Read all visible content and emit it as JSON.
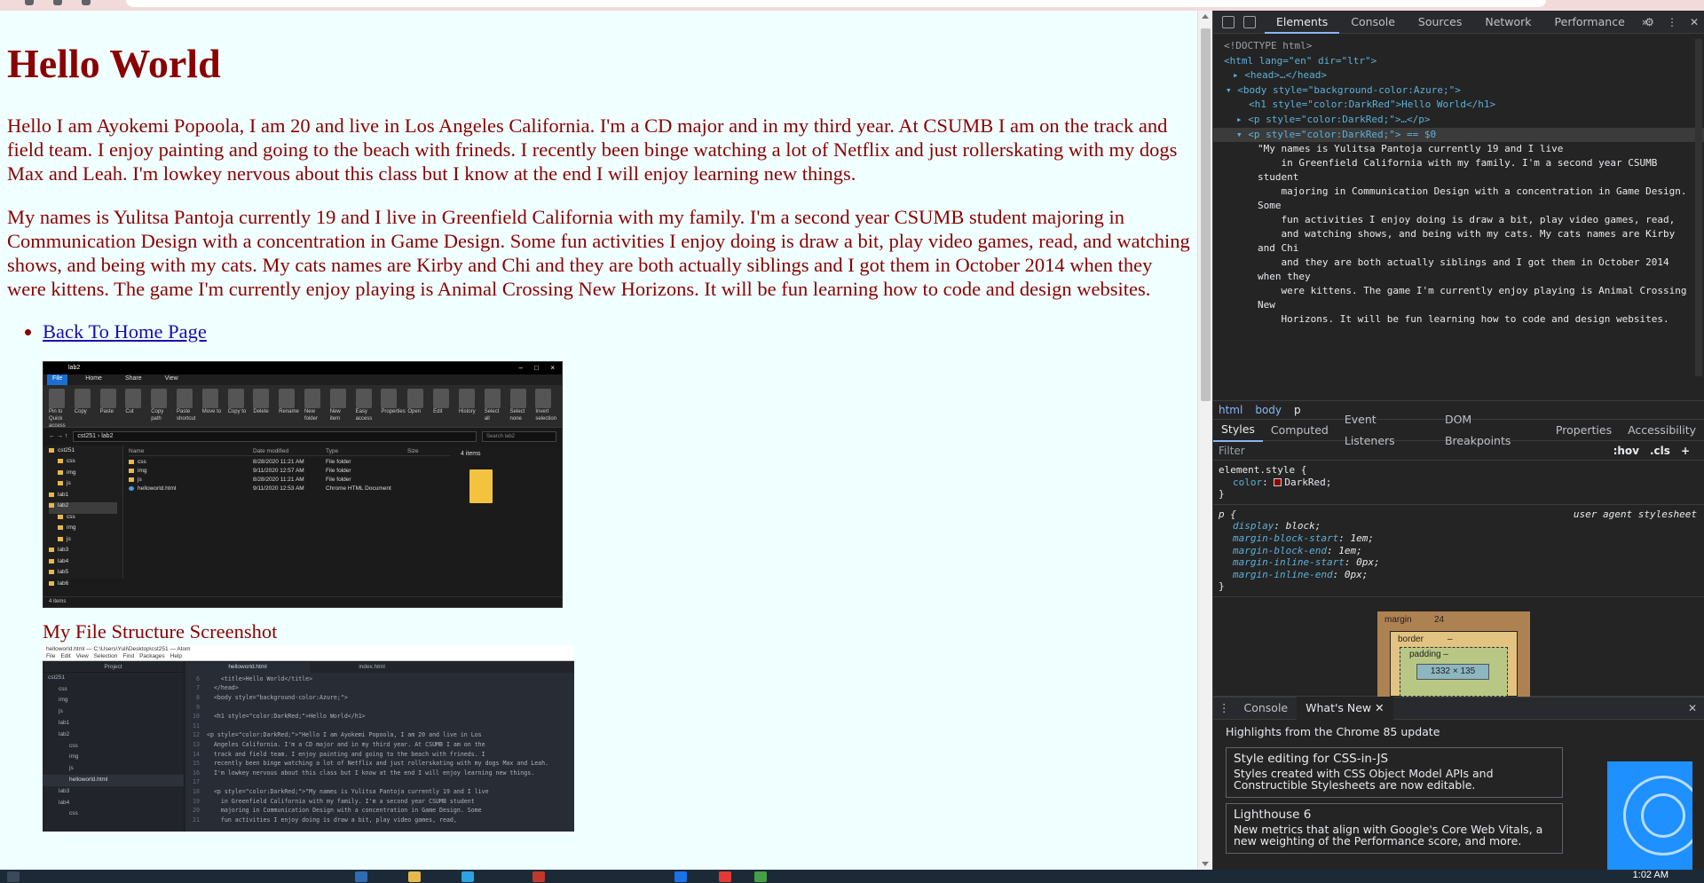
{
  "page": {
    "heading": "Hello World",
    "paragraph1": "Hello I am Ayokemi Popoola, I am 20 and live in Los Angeles California. I'm a CD major and in my third year. At CSUMB I am on the track and field team. I enjoy painting and going to the beach with frineds. I recently been binge watching a lot of Netflix and just rollerskating with my dogs Max and Leah. I'm lowkey nervous about this class but I know at the end I will enjoy learning new things.",
    "paragraph2": "My names is Yulitsa Pantoja currently 19 and I live in Greenfield California with my family. I'm a second year CSUMB student majoring in Communication Design with a concentration in Game Design. Some fun activities I enjoy doing is draw a bit, play video games, read, and watching shows, and being with my cats. My cats names are Kirby and Chi and they are both actually siblings and I got them in October 2014 when they were kittens. The game I'm currently enjoy playing is Animal Crossing New Horizons. It will be fun learning how to code and design websites.",
    "link": "Back To Home Page",
    "caption": "My File Structure Screenshot",
    "background": "#f0ffff",
    "text_color": "#8b0000"
  },
  "explorer": {
    "title": "lab2",
    "tabs": [
      "File",
      "Home",
      "Share",
      "View"
    ],
    "ribbon": [
      "Pin to Quick access",
      "Copy",
      "Paste",
      "Cut",
      "Copy path",
      "Paste shortcut",
      "Move to",
      "Copy to",
      "Delete",
      "Rename",
      "New folder",
      "New item",
      "Easy access",
      "Properties",
      "Open",
      "Edit",
      "History",
      "Select all",
      "Select none",
      "Invert selection"
    ],
    "address": "cst251 › lab2",
    "search": "Search lab2",
    "nav": [
      "cst251",
      "css",
      "img",
      "js",
      "lab1",
      "lab2",
      "css",
      "img",
      "js",
      "lab3",
      "lab4",
      "lab5",
      "lab6"
    ],
    "columns": [
      "Name",
      "Date modified",
      "Type",
      "Size"
    ],
    "rows": [
      {
        "name": "css",
        "date": "8/28/2020 11:21 AM",
        "type": "File folder",
        "size": ""
      },
      {
        "name": "img",
        "date": "9/11/2020 12:57 AM",
        "type": "File folder",
        "size": ""
      },
      {
        "name": "js",
        "date": "8/28/2020 11:21 AM",
        "type": "File folder",
        "size": ""
      },
      {
        "name": "helloworld.html",
        "date": "9/11/2020 12:53 AM",
        "type": "Chrome HTML Document",
        "size": ""
      }
    ],
    "count": "4 items",
    "status": "4 items"
  },
  "atom": {
    "title": "helloworld.html — C:\\Users\\Yuli\\Desktop\\cst251 — Atom",
    "menu": [
      "File",
      "Edit",
      "View",
      "Selection",
      "Find",
      "Packages",
      "Help"
    ],
    "tree_header": "Project",
    "tree": [
      "cst251",
      "css",
      "img",
      "js",
      "lab1",
      "lab2",
      "css",
      "img",
      "js",
      "helloworld.html",
      "lab3",
      "lab4",
      "css"
    ],
    "tabs": [
      "helloworld.html",
      "index.html"
    ],
    "lines": [
      {
        "n": "6",
        "t": "    <title>Hello World</title>"
      },
      {
        "n": "7",
        "t": "  </head>"
      },
      {
        "n": "8",
        "t": "  <body style=\"background-color:Azure;\">"
      },
      {
        "n": "9",
        "t": ""
      },
      {
        "n": "10",
        "t": "  <h1 style=\"color:DarkRed;\">Hello World</h1>"
      },
      {
        "n": "11",
        "t": ""
      },
      {
        "n": "12",
        "t": "<p style=\"color:DarkRed;\">\"Hello I am Ayokemi Popoola, I am 20 and live in Los"
      },
      {
        "n": "13",
        "t": "  Angeles California. I'm a CD major and in my third year. At CSUMB I am on the"
      },
      {
        "n": "14",
        "t": "  track and field team. I enjoy painting and going to the beach with frineds. I"
      },
      {
        "n": "15",
        "t": "  recently been binge watching a lot of Netflix and just rollerskating with my dogs Max and Leah."
      },
      {
        "n": "16",
        "t": "  I'm lowkey nervous about this class but I know at the end I will enjoy learning new things."
      },
      {
        "n": "17",
        "t": ""
      },
      {
        "n": "18",
        "t": "  <p style=\"color:DarkRed;\">\"My names is Yulitsa Pantoja currently 19 and I live"
      },
      {
        "n": "19",
        "t": "    in Greenfield California with my family. I'm a second year CSUMB student"
      },
      {
        "n": "20",
        "t": "    majoring in Communication Design with a concentration in Game Design. Some"
      },
      {
        "n": "21",
        "t": "    fun activities I enjoy doing is draw a bit, play video games, read,"
      }
    ]
  },
  "devtools": {
    "tabs": [
      "Elements",
      "Console",
      "Sources",
      "Network",
      "Performance"
    ],
    "more": "»",
    "dom": {
      "doctype": "<!DOCTYPE html>",
      "html_open": "<html lang=\"en\" dir=\"ltr\">",
      "head": "<head>…</head>",
      "body_open": "<body style=\"background-color:Azure;\">",
      "h1": "<h1 style=\"color:DarkRed\">Hello World</h1>",
      "p1": "<p style=\"color:DarkRed;\">…</p>",
      "p2": "<p style=\"color:DarkRed;\"> == $0",
      "text": "\"My names is Yulitsa Pantoja currently 19 and I live\n    in Greenfield California with my family. I'm a second year CSUMB student\n    majoring in Communication Design with a concentration in Game Design. Some\n    fun activities I enjoy doing is draw a bit, play video games, read,\n    and watching shows, and being with my cats. My cats names are Kirby and Chi\n    and they are both actually siblings and I got them in October 2014 when they\n    were kittens. The game I'm currently enjoy playing is Animal Crossing New\n    Horizons. It will be fun learning how to code and design websites."
    },
    "breadcrumbs": [
      "html",
      "body",
      "p"
    ],
    "style_tabs": [
      "Styles",
      "Computed",
      "Event Listeners",
      "DOM Breakpoints",
      "Properties",
      "Accessibility"
    ],
    "filter_placeholder": "Filter",
    "filter_hov": ":hov",
    "filter_cls": ".cls",
    "rule1": {
      "selector": "element.style {",
      "prop": "color",
      "value": "DarkRed;",
      "close": "}"
    },
    "rule2": {
      "selector": "p {",
      "source": "user agent stylesheet",
      "props": [
        {
          "p": "display",
          "v": "block;"
        },
        {
          "p": "margin-block-start",
          "v": "1em;"
        },
        {
          "p": "margin-block-end",
          "v": "1em;"
        },
        {
          "p": "margin-inline-start",
          "v": "0px;"
        },
        {
          "p": "margin-inline-end",
          "v": "0px;"
        }
      ],
      "close": "}"
    },
    "box": {
      "margin_label": "margin",
      "margin": "24",
      "border_label": "border",
      "border": "–",
      "padding_label": "padding –",
      "content": "1332 × 135",
      "side": "–"
    },
    "drawer_tabs": [
      "Console",
      "What's New"
    ],
    "whatsnew_title": "Highlights from the Chrome 85 update",
    "cards": [
      {
        "title": "Style editing for CSS-in-JS",
        "desc": "Styles created with CSS Object Model APIs and Constructible Stylesheets are now editable."
      },
      {
        "title": "Lighthouse 6",
        "desc": "New metrics that align with Google's Core Web Vitals, a new weighting of the Performance score, and more."
      }
    ]
  },
  "taskbar": {
    "clock": "1:02 AM"
  }
}
